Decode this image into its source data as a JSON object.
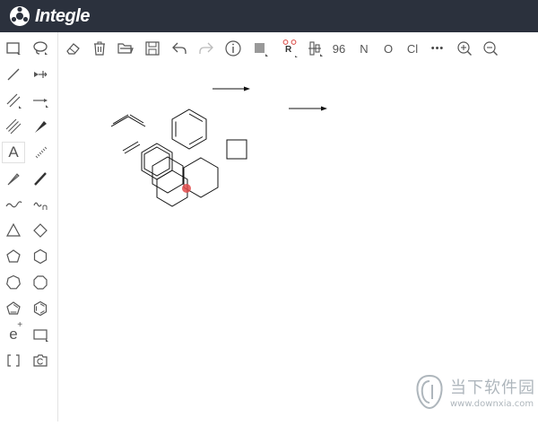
{
  "app": {
    "brand_name": "Integle",
    "colors": {
      "header_bg": "#2b313d",
      "icon": "#555555",
      "highlight_atom": "#e24b4b"
    }
  },
  "top_toolbar": {
    "atom_n": "N",
    "atom_o": "O",
    "atom_cl": "Cl",
    "charge_label": "R",
    "number_label": "96",
    "more": "•••",
    "icons": [
      "eraser-icon",
      "trash-icon",
      "open-folder-icon",
      "save-icon",
      "undo-icon",
      "redo-icon",
      "info-icon",
      "fill-square-icon",
      "rgroup-icon",
      "template-icon",
      "zoom-in-icon",
      "zoom-out-icon"
    ]
  },
  "left_toolbar": {
    "text_tool": "A",
    "element_tool": "e",
    "element_superscript": "+",
    "icons": [
      "rect-select-icon",
      "lasso-select-icon",
      "single-bond-icon",
      "move-arrow-icon",
      "double-bond-icon",
      "reaction-arrow-icon",
      "triple-bond-icon",
      "wedge-bond-icon",
      "text-icon",
      "hash-bond-icon",
      "hashed-wedge-icon",
      "bold-bond-icon",
      "wavy-line-icon",
      "wavy-bond-icon",
      "triangle-icon",
      "diamond-icon",
      "pentagon-icon",
      "hexagon-icon",
      "heptagon-icon",
      "octagon-icon",
      "cyclopentadiene-icon",
      "benzene-icon",
      "element-icon",
      "rectangle-icon",
      "bracket-icon",
      "camera-icon"
    ]
  },
  "watermark": {
    "cn": "当下软件园",
    "url": "www.downxia.com"
  }
}
